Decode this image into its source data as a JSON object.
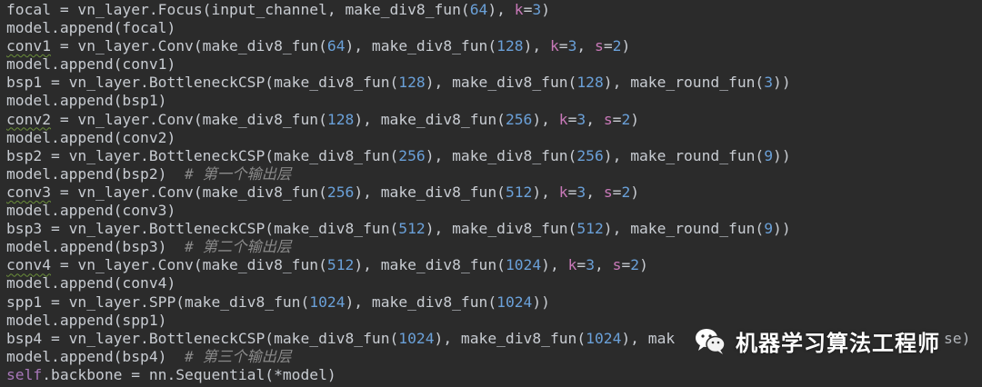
{
  "editor": {
    "lines": [
      [
        {
          "t": "focal = vn_layer.Focus(input_channel, make_div8_fun(",
          "c": "plain"
        },
        {
          "t": "64",
          "c": "num"
        },
        {
          "t": "), ",
          "c": "plain"
        },
        {
          "t": "k",
          "c": "kw"
        },
        {
          "t": "=",
          "c": "plain"
        },
        {
          "t": "3",
          "c": "num"
        },
        {
          "t": ")",
          "c": "plain"
        }
      ],
      [
        {
          "t": "model.append(focal)",
          "c": "plain"
        }
      ],
      [
        {
          "t": "conv1",
          "c": "plain",
          "w": true
        },
        {
          "t": " = vn_layer.Conv(make_div8_fun(",
          "c": "plain"
        },
        {
          "t": "64",
          "c": "num"
        },
        {
          "t": "), make_div8_fun(",
          "c": "plain"
        },
        {
          "t": "128",
          "c": "num"
        },
        {
          "t": "), ",
          "c": "plain"
        },
        {
          "t": "k",
          "c": "kw"
        },
        {
          "t": "=",
          "c": "plain"
        },
        {
          "t": "3",
          "c": "num"
        },
        {
          "t": ", ",
          "c": "plain"
        },
        {
          "t": "s",
          "c": "kw"
        },
        {
          "t": "=",
          "c": "plain"
        },
        {
          "t": "2",
          "c": "num"
        },
        {
          "t": ")",
          "c": "plain"
        }
      ],
      [
        {
          "t": "model.append(conv1)",
          "c": "plain"
        }
      ],
      [
        {
          "t": "bsp1 = vn_layer.BottleneckCSP(make_div8_fun(",
          "c": "plain"
        },
        {
          "t": "128",
          "c": "num"
        },
        {
          "t": "), make_div8_fun(",
          "c": "plain"
        },
        {
          "t": "128",
          "c": "num"
        },
        {
          "t": "), make_round_fun(",
          "c": "plain"
        },
        {
          "t": "3",
          "c": "num"
        },
        {
          "t": "))",
          "c": "plain"
        }
      ],
      [
        {
          "t": "model.append(bsp1)",
          "c": "plain"
        }
      ],
      [
        {
          "t": "conv2",
          "c": "plain",
          "w": true
        },
        {
          "t": " = vn_layer.Conv(make_div8_fun(",
          "c": "plain"
        },
        {
          "t": "128",
          "c": "num"
        },
        {
          "t": "), make_div8_fun(",
          "c": "plain"
        },
        {
          "t": "256",
          "c": "num"
        },
        {
          "t": "), ",
          "c": "plain"
        },
        {
          "t": "k",
          "c": "kw"
        },
        {
          "t": "=",
          "c": "plain"
        },
        {
          "t": "3",
          "c": "num"
        },
        {
          "t": ", ",
          "c": "plain"
        },
        {
          "t": "s",
          "c": "kw"
        },
        {
          "t": "=",
          "c": "plain"
        },
        {
          "t": "2",
          "c": "num"
        },
        {
          "t": ")",
          "c": "plain"
        }
      ],
      [
        {
          "t": "model.append(conv2)",
          "c": "plain"
        }
      ],
      [
        {
          "t": "bsp2 = vn_layer.BottleneckCSP(make_div8_fun(",
          "c": "plain"
        },
        {
          "t": "256",
          "c": "num"
        },
        {
          "t": "), make_div8_fun(",
          "c": "plain"
        },
        {
          "t": "256",
          "c": "num"
        },
        {
          "t": "), make_round_fun(",
          "c": "plain"
        },
        {
          "t": "9",
          "c": "num"
        },
        {
          "t": "))",
          "c": "plain"
        }
      ],
      [
        {
          "t": "model.append(bsp2)  ",
          "c": "plain"
        },
        {
          "t": "# 第一个输出层",
          "c": "comment"
        }
      ],
      [
        {
          "t": "conv3",
          "c": "plain",
          "w": true
        },
        {
          "t": " = vn_layer.Conv(make_div8_fun(",
          "c": "plain"
        },
        {
          "t": "256",
          "c": "num"
        },
        {
          "t": "), make_div8_fun(",
          "c": "plain"
        },
        {
          "t": "512",
          "c": "num"
        },
        {
          "t": "), ",
          "c": "plain"
        },
        {
          "t": "k",
          "c": "kw"
        },
        {
          "t": "=",
          "c": "plain"
        },
        {
          "t": "3",
          "c": "num"
        },
        {
          "t": ", ",
          "c": "plain"
        },
        {
          "t": "s",
          "c": "kw"
        },
        {
          "t": "=",
          "c": "plain"
        },
        {
          "t": "2",
          "c": "num"
        },
        {
          "t": ")",
          "c": "plain"
        }
      ],
      [
        {
          "t": "model.append(conv3)",
          "c": "plain"
        }
      ],
      [
        {
          "t": "bsp3 = vn_layer.BottleneckCSP(make_div8_fun(",
          "c": "plain"
        },
        {
          "t": "512",
          "c": "num"
        },
        {
          "t": "), make_div8_fun(",
          "c": "plain"
        },
        {
          "t": "512",
          "c": "num"
        },
        {
          "t": "), make_round_fun(",
          "c": "plain"
        },
        {
          "t": "9",
          "c": "num"
        },
        {
          "t": "))",
          "c": "plain"
        }
      ],
      [
        {
          "t": "model.append(bsp3)  ",
          "c": "plain"
        },
        {
          "t": "# 第二个输出层",
          "c": "comment"
        }
      ],
      [
        {
          "t": "conv4",
          "c": "plain",
          "w": true
        },
        {
          "t": " = vn_layer.Conv(make_div8_fun(",
          "c": "plain"
        },
        {
          "t": "512",
          "c": "num"
        },
        {
          "t": "), make_div8_fun(",
          "c": "plain"
        },
        {
          "t": "1024",
          "c": "num"
        },
        {
          "t": "), ",
          "c": "plain"
        },
        {
          "t": "k",
          "c": "kw"
        },
        {
          "t": "=",
          "c": "plain"
        },
        {
          "t": "3",
          "c": "num"
        },
        {
          "t": ", ",
          "c": "plain"
        },
        {
          "t": "s",
          "c": "kw"
        },
        {
          "t": "=",
          "c": "plain"
        },
        {
          "t": "2",
          "c": "num"
        },
        {
          "t": ")",
          "c": "plain"
        }
      ],
      [
        {
          "t": "model.append(conv4)",
          "c": "plain"
        }
      ],
      [
        {
          "t": "spp1 = vn_layer.SPP(make_div8_fun(",
          "c": "plain"
        },
        {
          "t": "1024",
          "c": "num"
        },
        {
          "t": "), make_div8_fun(",
          "c": "plain"
        },
        {
          "t": "1024",
          "c": "num"
        },
        {
          "t": "))",
          "c": "plain"
        }
      ],
      [
        {
          "t": "model.append(spp1)",
          "c": "plain"
        }
      ],
      [
        {
          "t": "bsp4 = vn_layer.BottleneckCSP(make_div8_fun(",
          "c": "plain"
        },
        {
          "t": "1024",
          "c": "num"
        },
        {
          "t": "), make_div8_fun(",
          "c": "plain"
        },
        {
          "t": "1024",
          "c": "num"
        },
        {
          "t": "), mak",
          "c": "plain"
        }
      ],
      [
        {
          "t": "model.append(bsp4)  ",
          "c": "plain"
        },
        {
          "t": "# 第三个输出层",
          "c": "comment"
        }
      ],
      [
        {
          "t": "self",
          "c": "self"
        },
        {
          "t": ".backbone = nn.Sequential(*model)",
          "c": "plain"
        }
      ]
    ],
    "line_tail_behind_watermark": [
      {
        "line": 18,
        "t": "se)",
        "c": "plain"
      }
    ]
  },
  "watermark": {
    "icon": "wechat-icon",
    "text": "机器学习算法工程师"
  },
  "colors": {
    "background": "#2b2b2b",
    "text": "#c8ccd2",
    "number": "#6aa0d8",
    "keyword_arg": "#c879b8",
    "self": "#a877b9",
    "comment": "#8a8a8a"
  }
}
